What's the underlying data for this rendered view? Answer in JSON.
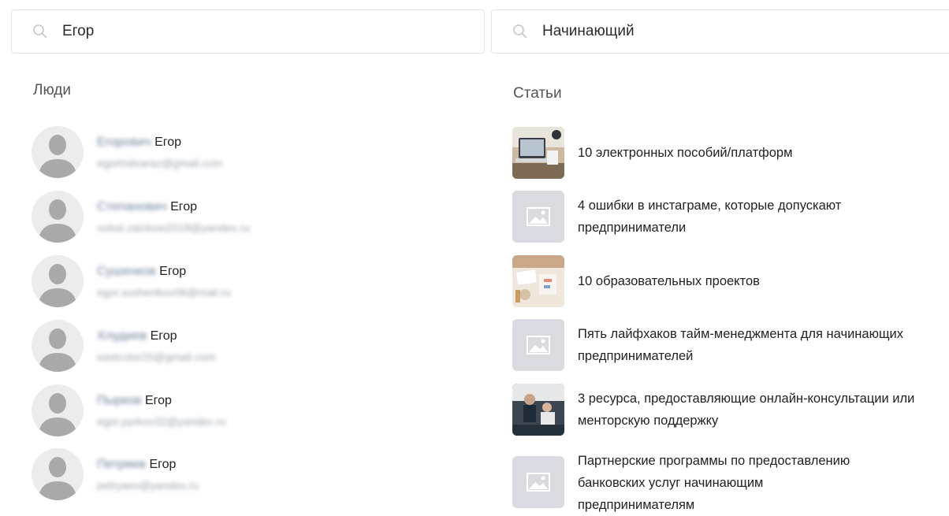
{
  "search_people": {
    "value": "Егор"
  },
  "search_articles": {
    "value": "Начинающий"
  },
  "people": {
    "title": "Люди",
    "items": [
      {
        "surname": "Егорович",
        "first": "Егор",
        "email": "egortridvaraz@gmail.com"
      },
      {
        "surname": "Степанович",
        "first": "Егор",
        "email": "volod.zaickow2018@yandex.ru"
      },
      {
        "surname": "Сушенков",
        "first": "Егор",
        "email": "egor.sushenkov06@mail.ru"
      },
      {
        "surname": "Хлудиев",
        "first": "Егор",
        "email": "eastcolor25@gmail.com"
      },
      {
        "surname": "Пырков",
        "first": "Егор",
        "email": "egor.pyrkov32@yandex.ru"
      },
      {
        "surname": "Петряев",
        "first": "Егор",
        "email": "petryaev@yandex.ru"
      }
    ]
  },
  "articles": {
    "title": "Статьи",
    "items": [
      {
        "title": "10 электронных пособий/платформ",
        "thumb": "photo-laptop"
      },
      {
        "title": "4 ошибки в инстаграме, которые допускают предприниматели",
        "thumb": "image-placeholder-icon"
      },
      {
        "title": "10 образовательных проектов",
        "thumb": "photo-desk"
      },
      {
        "title": "Пять лайфхаков тайм-менеджмента для начинающих предпринимателей",
        "thumb": "image-placeholder-icon"
      },
      {
        "title": "3 ресурса, предоставляющие онлайн-консультации или менторскую поддержку",
        "thumb": "photo-meeting"
      },
      {
        "title": "Партнерские программы по предоставлению банковских услуг начинающим предпринимателям",
        "thumb": "image-placeholder-icon"
      }
    ]
  }
}
